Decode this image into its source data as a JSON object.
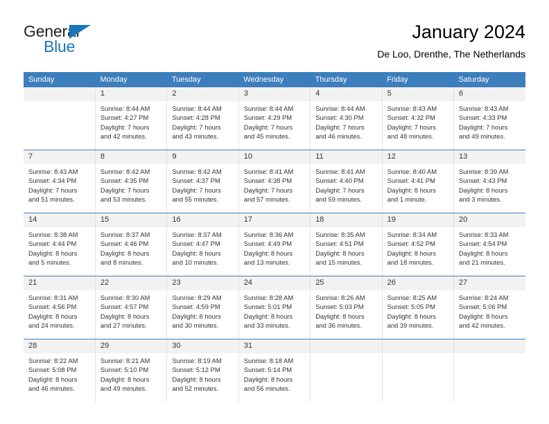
{
  "brand": {
    "name_part1": "General",
    "name_part2": "Blue"
  },
  "header": {
    "title": "January 2024",
    "subtitle": "De Loo, Drenthe, The Netherlands"
  },
  "colors": {
    "header_blue": "#3d7ebd",
    "brand_blue": "#1b75bb",
    "daynum_bg": "#f2f2f2",
    "text": "#333333"
  },
  "weekday_headers": [
    "Sunday",
    "Monday",
    "Tuesday",
    "Wednesday",
    "Thursday",
    "Friday",
    "Saturday"
  ],
  "weeks": [
    [
      {
        "day": "",
        "sunrise": "",
        "sunset": "",
        "daylight_line1": "",
        "daylight_line2": "",
        "empty": true
      },
      {
        "day": "1",
        "sunrise": "Sunrise: 8:44 AM",
        "sunset": "Sunset: 4:27 PM",
        "daylight_line1": "Daylight: 7 hours",
        "daylight_line2": "and 42 minutes."
      },
      {
        "day": "2",
        "sunrise": "Sunrise: 8:44 AM",
        "sunset": "Sunset: 4:28 PM",
        "daylight_line1": "Daylight: 7 hours",
        "daylight_line2": "and 43 minutes."
      },
      {
        "day": "3",
        "sunrise": "Sunrise: 8:44 AM",
        "sunset": "Sunset: 4:29 PM",
        "daylight_line1": "Daylight: 7 hours",
        "daylight_line2": "and 45 minutes."
      },
      {
        "day": "4",
        "sunrise": "Sunrise: 8:44 AM",
        "sunset": "Sunset: 4:30 PM",
        "daylight_line1": "Daylight: 7 hours",
        "daylight_line2": "and 46 minutes."
      },
      {
        "day": "5",
        "sunrise": "Sunrise: 8:43 AM",
        "sunset": "Sunset: 4:32 PM",
        "daylight_line1": "Daylight: 7 hours",
        "daylight_line2": "and 48 minutes."
      },
      {
        "day": "6",
        "sunrise": "Sunrise: 8:43 AM",
        "sunset": "Sunset: 4:33 PM",
        "daylight_line1": "Daylight: 7 hours",
        "daylight_line2": "and 49 minutes."
      }
    ],
    [
      {
        "day": "7",
        "sunrise": "Sunrise: 8:43 AM",
        "sunset": "Sunset: 4:34 PM",
        "daylight_line1": "Daylight: 7 hours",
        "daylight_line2": "and 51 minutes."
      },
      {
        "day": "8",
        "sunrise": "Sunrise: 8:42 AM",
        "sunset": "Sunset: 4:35 PM",
        "daylight_line1": "Daylight: 7 hours",
        "daylight_line2": "and 53 minutes."
      },
      {
        "day": "9",
        "sunrise": "Sunrise: 8:42 AM",
        "sunset": "Sunset: 4:37 PM",
        "daylight_line1": "Daylight: 7 hours",
        "daylight_line2": "and 55 minutes."
      },
      {
        "day": "10",
        "sunrise": "Sunrise: 8:41 AM",
        "sunset": "Sunset: 4:38 PM",
        "daylight_line1": "Daylight: 7 hours",
        "daylight_line2": "and 57 minutes."
      },
      {
        "day": "11",
        "sunrise": "Sunrise: 8:41 AM",
        "sunset": "Sunset: 4:40 PM",
        "daylight_line1": "Daylight: 7 hours",
        "daylight_line2": "and 59 minutes."
      },
      {
        "day": "12",
        "sunrise": "Sunrise: 8:40 AM",
        "sunset": "Sunset: 4:41 PM",
        "daylight_line1": "Daylight: 8 hours",
        "daylight_line2": "and 1 minute."
      },
      {
        "day": "13",
        "sunrise": "Sunrise: 8:39 AM",
        "sunset": "Sunset: 4:43 PM",
        "daylight_line1": "Daylight: 8 hours",
        "daylight_line2": "and 3 minutes."
      }
    ],
    [
      {
        "day": "14",
        "sunrise": "Sunrise: 8:38 AM",
        "sunset": "Sunset: 4:44 PM",
        "daylight_line1": "Daylight: 8 hours",
        "daylight_line2": "and 5 minutes."
      },
      {
        "day": "15",
        "sunrise": "Sunrise: 8:37 AM",
        "sunset": "Sunset: 4:46 PM",
        "daylight_line1": "Daylight: 8 hours",
        "daylight_line2": "and 8 minutes."
      },
      {
        "day": "16",
        "sunrise": "Sunrise: 8:37 AM",
        "sunset": "Sunset: 4:47 PM",
        "daylight_line1": "Daylight: 8 hours",
        "daylight_line2": "and 10 minutes."
      },
      {
        "day": "17",
        "sunrise": "Sunrise: 8:36 AM",
        "sunset": "Sunset: 4:49 PM",
        "daylight_line1": "Daylight: 8 hours",
        "daylight_line2": "and 13 minutes."
      },
      {
        "day": "18",
        "sunrise": "Sunrise: 8:35 AM",
        "sunset": "Sunset: 4:51 PM",
        "daylight_line1": "Daylight: 8 hours",
        "daylight_line2": "and 15 minutes."
      },
      {
        "day": "19",
        "sunrise": "Sunrise: 8:34 AM",
        "sunset": "Sunset: 4:52 PM",
        "daylight_line1": "Daylight: 8 hours",
        "daylight_line2": "and 18 minutes."
      },
      {
        "day": "20",
        "sunrise": "Sunrise: 8:33 AM",
        "sunset": "Sunset: 4:54 PM",
        "daylight_line1": "Daylight: 8 hours",
        "daylight_line2": "and 21 minutes."
      }
    ],
    [
      {
        "day": "21",
        "sunrise": "Sunrise: 8:31 AM",
        "sunset": "Sunset: 4:56 PM",
        "daylight_line1": "Daylight: 8 hours",
        "daylight_line2": "and 24 minutes."
      },
      {
        "day": "22",
        "sunrise": "Sunrise: 8:30 AM",
        "sunset": "Sunset: 4:57 PM",
        "daylight_line1": "Daylight: 8 hours",
        "daylight_line2": "and 27 minutes."
      },
      {
        "day": "23",
        "sunrise": "Sunrise: 8:29 AM",
        "sunset": "Sunset: 4:59 PM",
        "daylight_line1": "Daylight: 8 hours",
        "daylight_line2": "and 30 minutes."
      },
      {
        "day": "24",
        "sunrise": "Sunrise: 8:28 AM",
        "sunset": "Sunset: 5:01 PM",
        "daylight_line1": "Daylight: 8 hours",
        "daylight_line2": "and 33 minutes."
      },
      {
        "day": "25",
        "sunrise": "Sunrise: 8:26 AM",
        "sunset": "Sunset: 5:03 PM",
        "daylight_line1": "Daylight: 8 hours",
        "daylight_line2": "and 36 minutes."
      },
      {
        "day": "26",
        "sunrise": "Sunrise: 8:25 AM",
        "sunset": "Sunset: 5:05 PM",
        "daylight_line1": "Daylight: 8 hours",
        "daylight_line2": "and 39 minutes."
      },
      {
        "day": "27",
        "sunrise": "Sunrise: 8:24 AM",
        "sunset": "Sunset: 5:06 PM",
        "daylight_line1": "Daylight: 8 hours",
        "daylight_line2": "and 42 minutes."
      }
    ],
    [
      {
        "day": "28",
        "sunrise": "Sunrise: 8:22 AM",
        "sunset": "Sunset: 5:08 PM",
        "daylight_line1": "Daylight: 8 hours",
        "daylight_line2": "and 46 minutes."
      },
      {
        "day": "29",
        "sunrise": "Sunrise: 8:21 AM",
        "sunset": "Sunset: 5:10 PM",
        "daylight_line1": "Daylight: 8 hours",
        "daylight_line2": "and 49 minutes."
      },
      {
        "day": "30",
        "sunrise": "Sunrise: 8:19 AM",
        "sunset": "Sunset: 5:12 PM",
        "daylight_line1": "Daylight: 8 hours",
        "daylight_line2": "and 52 minutes."
      },
      {
        "day": "31",
        "sunrise": "Sunrise: 8:18 AM",
        "sunset": "Sunset: 5:14 PM",
        "daylight_line1": "Daylight: 8 hours",
        "daylight_line2": "and 56 minutes."
      },
      {
        "day": "",
        "sunrise": "",
        "sunset": "",
        "daylight_line1": "",
        "daylight_line2": "",
        "empty": true,
        "blank": true
      },
      {
        "day": "",
        "sunrise": "",
        "sunset": "",
        "daylight_line1": "",
        "daylight_line2": "",
        "empty": true,
        "blank": true
      },
      {
        "day": "",
        "sunrise": "",
        "sunset": "",
        "daylight_line1": "",
        "daylight_line2": "",
        "empty": true,
        "blank": true
      }
    ]
  ]
}
